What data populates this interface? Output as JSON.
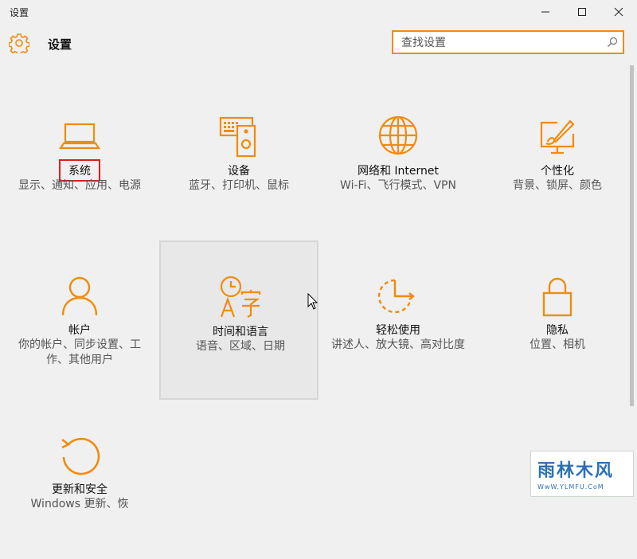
{
  "window": {
    "title": "设置",
    "minimize_icon": "minimize-icon",
    "maximize_icon": "maximize-icon",
    "close_icon": "close-icon"
  },
  "header": {
    "icon": "gear-icon",
    "title": "设置"
  },
  "search": {
    "placeholder": "查找设置",
    "value": "",
    "icon": "search-icon"
  },
  "accent_color": "#f08c0c",
  "categories": [
    {
      "icon": "laptop-icon",
      "label": "系统",
      "description": "显示、通知、应用、电源",
      "selected": true
    },
    {
      "icon": "devices-icon",
      "label": "设备",
      "description": "蓝牙、打印机、鼠标"
    },
    {
      "icon": "globe-icon",
      "label": "网络和 Internet",
      "description": "Wi-Fi、飞行模式、VPN"
    },
    {
      "icon": "personalization-icon",
      "label": "个性化",
      "description": "背景、锁屏、颜色"
    },
    {
      "icon": "user-icon",
      "label": "帐户",
      "description": "你的帐户、同步设置、工作、其他用户"
    },
    {
      "icon": "time-language-icon",
      "label": "时间和语言",
      "description": "语音、区域、日期",
      "hovered": true
    },
    {
      "icon": "ease-of-access-icon",
      "label": "轻松使用",
      "description": "讲述人、放大镜、高对比度"
    },
    {
      "icon": "lock-icon",
      "label": "隐私",
      "description": "位置、相机"
    },
    {
      "icon": "update-icon",
      "label": "更新和安全",
      "description": "Windows 更新、恢"
    }
  ],
  "watermark": {
    "logo_text": "雨林木风",
    "url": "WwW.YLMFU.CoM"
  }
}
